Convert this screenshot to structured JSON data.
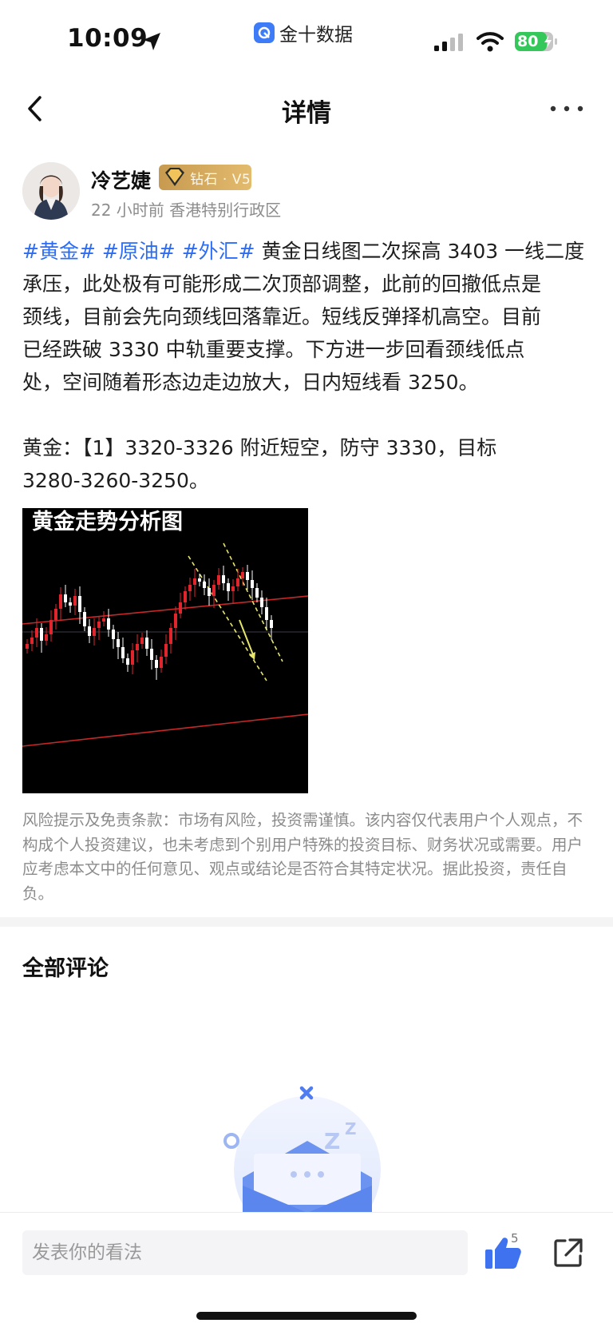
{
  "status_bar": {
    "time": "10:09",
    "app_name": "金十数据",
    "battery": "80",
    "location_icon": "location-arrow-icon",
    "signal_icon": "cellular-signal-icon",
    "wifi_icon": "wifi-icon",
    "battery_icon": "battery-charging-icon"
  },
  "nav": {
    "title": "详情",
    "back_icon": "chevron-left-icon",
    "more_icon": "more-dots-icon"
  },
  "author": {
    "name": "冷艺婕",
    "level": "钻石 · V5",
    "time_ago": "22 小时前",
    "location": "香港特别行政区"
  },
  "post": {
    "tags": [
      "#黄金#",
      "#原油#",
      "#外汇#"
    ],
    "line1_text": " 黄金日线图二次探高 3403 一线二度",
    "lines": [
      "承压，此处极有可能形成二次顶部调整，此前的回撤低点是",
      "颈线，目前会先向颈线回落靠近。短线反弹择机高空。目前",
      "已经跌破 3330 中轨重要支撑。下方进一步回看颈线低点",
      "处，空间随着形态边走边放大，日内短线看 3250。"
    ],
    "plan_line1": "黄金：【1】3320-3326 附近短空，防守 3330，目标",
    "plan_line2": " 3280-3260-3250。",
    "image_title": "黄金走势分析图"
  },
  "disclaimer": "风险提示及免责条款：市场有风险，投资需谨慎。该内容仅代表用户个人观点，不构成个人投资建议，也未考虑到个别用户特殊的投资目标、财务状况或需要。用户应考虑本文中的任何意见、观点或结论是否符合其特定状况。据此投资，责任自负。",
  "comments": {
    "title": "全部评论",
    "empty_illustration": "empty-mailbox-illustration"
  },
  "bottom_bar": {
    "input_placeholder": "发表你的看法",
    "like_count": "5",
    "like_icon": "thumbs-up-icon",
    "share_icon": "share-external-icon"
  },
  "colors": {
    "tag_blue": "#2d6df4",
    "badge_gold": "#d4a85c",
    "candle_up": "#e0262c",
    "candle_down": "#ffffff",
    "trend_line": "#c62828",
    "channel_line": "#e6e66a"
  }
}
